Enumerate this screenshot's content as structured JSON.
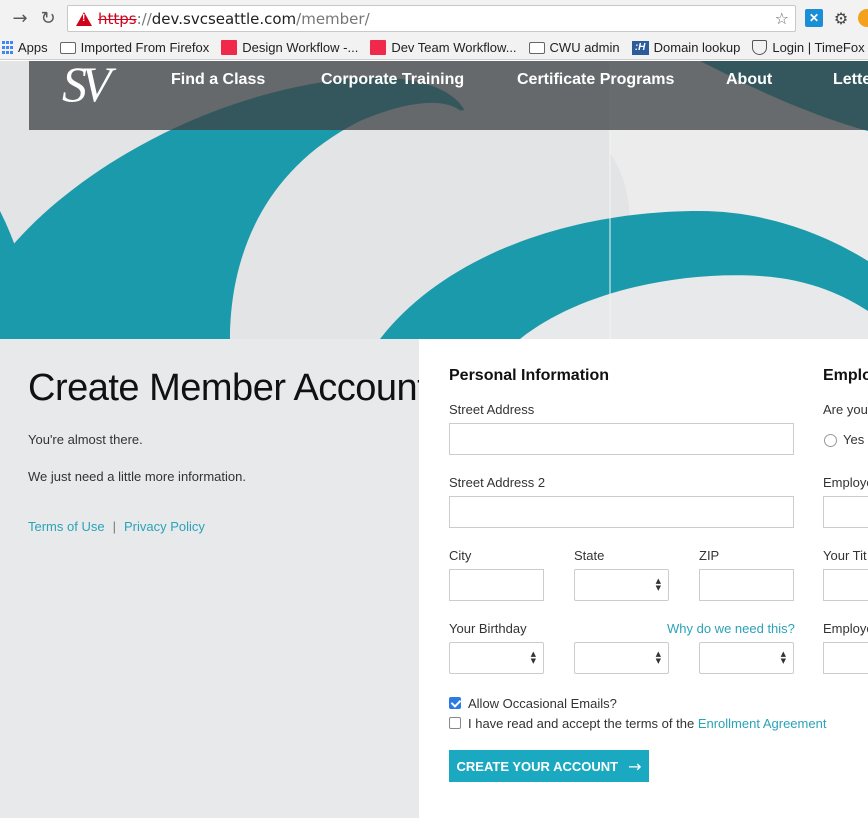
{
  "browser": {
    "url_scheme": "https",
    "url_sep": "://",
    "url_host": "dev.svcseattle.com",
    "url_path": "/member/",
    "bookmarks": [
      {
        "label": "Apps",
        "icon": "apps-grid-icon"
      },
      {
        "label": "Imported From Firefox",
        "icon": "folder-icon"
      },
      {
        "label": "Design Workflow -...",
        "icon": "red-square-icon"
      },
      {
        "label": "Dev Team Workflow...",
        "icon": "red-square-icon"
      },
      {
        "label": "CWU admin",
        "icon": "folder-icon"
      },
      {
        "label": "Domain lookup",
        "icon": "h-icon"
      },
      {
        "label": "Login | TimeFox | F...",
        "icon": "shield-icon"
      }
    ]
  },
  "site": {
    "logo": "SV",
    "nav": [
      "Find a Class",
      "Corporate Training",
      "Certificate Programs",
      "About",
      "Lette"
    ]
  },
  "left": {
    "title": "Create Member Account",
    "line1": "You're almost there.",
    "line2": "We just need a little more information.",
    "terms": "Terms of Use",
    "separator": "|",
    "privacy": "Privacy Policy"
  },
  "form": {
    "personal_heading": "Personal Information",
    "employment_heading": "Emplo",
    "street": "Street Address",
    "street2": "Street Address 2",
    "city": "City",
    "state": "State",
    "zip": "ZIP",
    "birthday": "Your Birthday",
    "why": "Why do we need this?",
    "allow_emails": "Allow Occasional Emails?",
    "terms_prefix": "I have read and accept the terms of the ",
    "terms_link": "Enrollment Agreement",
    "submit": "CREATE YOUR ACCOUNT",
    "right_are_you": "Are you",
    "right_yes": "Yes",
    "right_employer": "Employe",
    "right_title": "Your Tit",
    "right_employer2": "Employe"
  },
  "colors": {
    "accent": "#1ba9c1",
    "link": "#2aa3b8",
    "hero_teal": "#1a9aaa",
    "panel_gray": "#e8e9eb"
  }
}
